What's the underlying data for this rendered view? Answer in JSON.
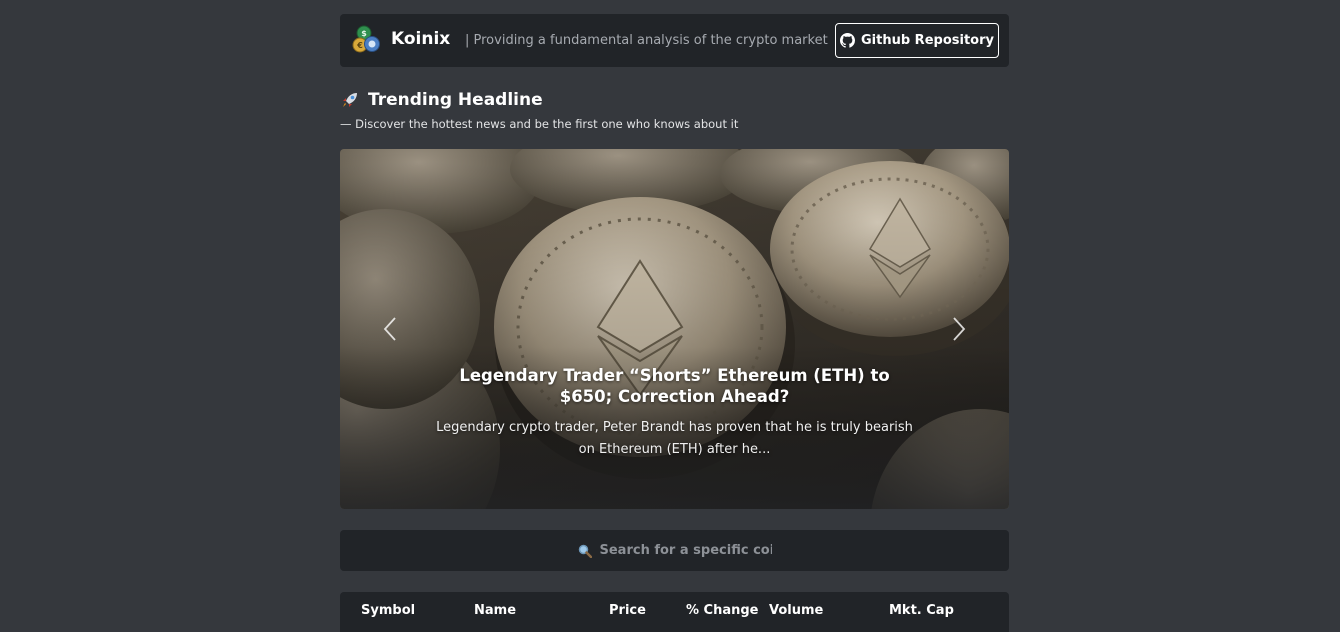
{
  "navbar": {
    "brand": "Koinix",
    "tagline": "| Providing a fundamental analysis of the crypto market",
    "github_label": "Github Repository",
    "logo_icon": "coins-logo-icon",
    "github_icon": "github-icon"
  },
  "trending": {
    "title": "Trending Headline",
    "title_icon": "rocket-icon",
    "subtitle": "— Discover the hottest news and be the first one who knows about it"
  },
  "carousel": {
    "headline": "Legendary Trader “Shorts” Ethereum (ETH) to $650; Correction Ahead?",
    "summary": "Legendary crypto trader, Peter Brandt has proven that he is truly bearish on Ethereum (ETH) after he...",
    "prev_icon": "chevron-left-icon",
    "next_icon": "chevron-right-icon"
  },
  "search": {
    "placeholder": "Search for a specific coin",
    "icon": "search-icon"
  },
  "table": {
    "columns": [
      "Symbol",
      "Name",
      "Price",
      "% Change",
      "Volume",
      "Mkt. Cap"
    ]
  },
  "colors": {
    "background": "#35383d",
    "panel": "#212428",
    "text": "#ffffff",
    "muted": "#a6aab0"
  }
}
